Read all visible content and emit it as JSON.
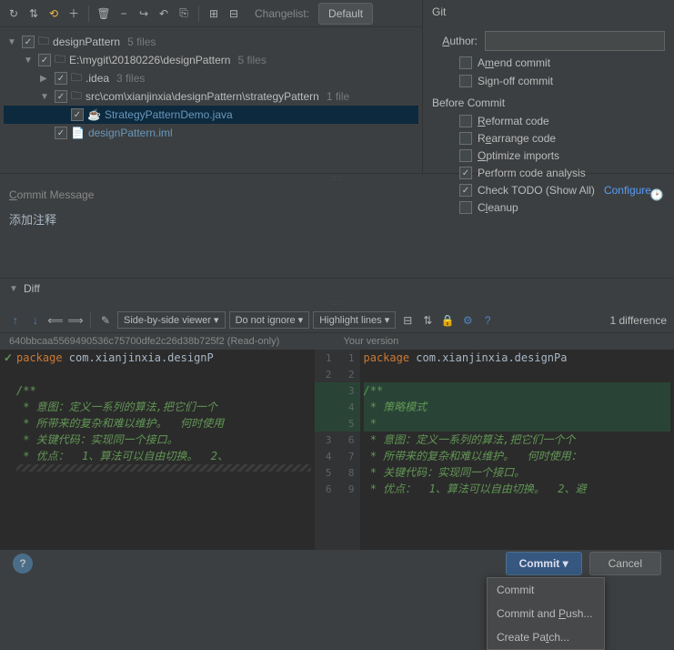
{
  "toolbar": {
    "changelist_label": "Changelist:",
    "changelist_value": "Default"
  },
  "tree": {
    "root": {
      "label": "designPattern",
      "count": "5 files"
    },
    "path": {
      "label": "E:\\mygit\\20180226\\designPattern",
      "count": "5 files"
    },
    "idea": {
      "label": ".idea",
      "count": "3 files"
    },
    "src": {
      "label": "src\\com\\xianjinxia\\designPattern\\strategyPattern",
      "count": "1 file"
    },
    "file1": {
      "label": "StrategyPatternDemo.java"
    },
    "file2": {
      "label": "designPattern.iml"
    }
  },
  "git": {
    "header": "Git",
    "author_label": "Author:",
    "author_value": "",
    "amend": "Amend commit",
    "signoff": "Sign-off commit"
  },
  "before_commit": {
    "header": "Before Commit",
    "reformat": "Reformat code",
    "rearrange": "Rearrange code",
    "optimize": "Optimize imports",
    "analysis": "Perform code analysis",
    "todo": "Check TODO (Show All)",
    "configure": "Configure",
    "cleanup": "Cleanup"
  },
  "commit_msg": {
    "label": "Commit Message",
    "text": "添加注释"
  },
  "diff": {
    "label": "Diff",
    "viewer": "Side-by-side viewer ▾",
    "ignore": "Do not ignore ▾",
    "highlight": "Highlight lines ▾",
    "count": "1 difference",
    "left_info": "640bbcaa5569490536c75700dfe2c26d38b725f2 (Read-only)",
    "right_info": "Your version"
  },
  "code_left": {
    "l1": "package com.xianjinxia.designP",
    "l2": "/**",
    "l3": " * 意图：定义一系列的算法,把它们一个",
    "l4": " * 所带来的复杂和难以维护。  何时使用",
    "l5": " * 关键代码：实现同一个接口。",
    "l6": " * 优点：  1、算法可以自由切换。  2、"
  },
  "code_right": {
    "l1": "package com.xianjinxia.designPa",
    "l2": "/**",
    "l3": " * 策略模式",
    "l4": " *",
    "l5": " * 意图：定义一系列的算法,把它们一个个",
    "l6": " * 所带来的复杂和难以维护。  何时使用：",
    "l7": " * 关键代码：实现同一个接口。",
    "l8": " * 优点：  1、算法可以自由切换。  2、避"
  },
  "gutter_left": [
    "1",
    "2",
    "3",
    "4",
    "5",
    "6"
  ],
  "gutter_right_old": [
    "1",
    "2",
    "",
    "",
    "",
    "3",
    "4",
    "5",
    "6"
  ],
  "gutter_right_new": [
    "1",
    "2",
    "3",
    "4",
    "5",
    "6",
    "7",
    "8",
    "9"
  ],
  "buttons": {
    "commit": "Commit ▾",
    "cancel": "Cancel"
  },
  "popup": {
    "commit": "Commit",
    "push": "Commit and Push...",
    "patch": "Create Patch..."
  }
}
